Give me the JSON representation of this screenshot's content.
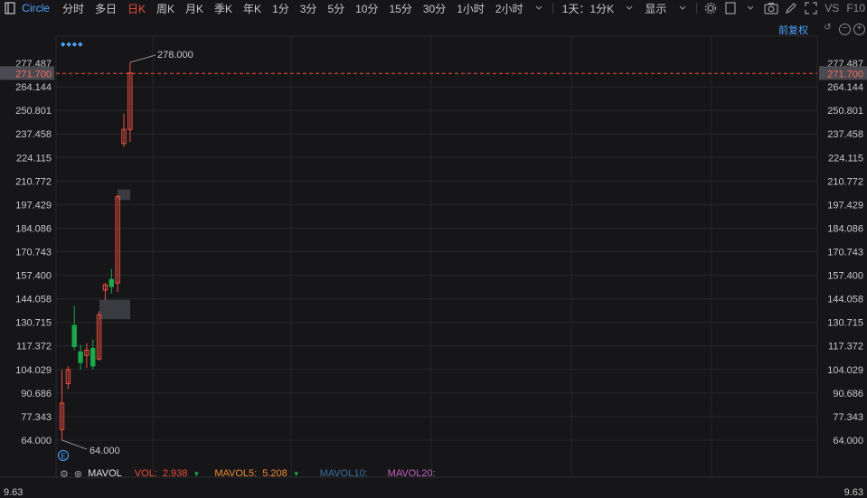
{
  "toolbar": {
    "symbol": "Circle",
    "intervals": [
      "分时",
      "多日",
      "日K",
      "周K",
      "月K",
      "季K",
      "年K",
      "1分",
      "3分",
      "5分",
      "10分",
      "15分",
      "30分",
      "1小时",
      "2小时"
    ],
    "active_interval": "日K",
    "range_selector": "1天：1分K",
    "display_label": "显示",
    "vs_label": "VS",
    "f10_label": "F10"
  },
  "chart_header": {
    "adjust_label": "前复权"
  },
  "price_axis": {
    "ticks": [
      "277.487",
      "264.144",
      "250.801",
      "237.458",
      "224.115",
      "210.772",
      "197.429",
      "184.086",
      "170.743",
      "157.400",
      "144.058",
      "130.715",
      "117.372",
      "104.029",
      "90.686",
      "77.343",
      "64.000"
    ],
    "current_price": "271.700"
  },
  "annotations": {
    "high_label": "278.000",
    "low_label": "64.000"
  },
  "volume_panel": {
    "indicator": "MAVOL",
    "vol_label": "VOL:",
    "vol_value": "2.938",
    "mavol5_label": "MAVOL5:",
    "mavol5_value": "5.208",
    "mavol10_label": "MAVOL10:",
    "mavol20_label": "MAVOL20:",
    "axis_value": "9.63"
  },
  "colors": {
    "up": "#ef4f3f",
    "down": "#1aa84a",
    "accent": "#4da3ff",
    "mavol5": "#f08a30",
    "mavol10": "#3a6fa0",
    "mavol20": "#c060c0"
  },
  "chart_data": {
    "type": "candlestick",
    "ylim": [
      64.0,
      277.487
    ],
    "candles": [
      {
        "o": 70,
        "h": 104,
        "l": 64,
        "c": 85
      },
      {
        "o": 96,
        "h": 106,
        "l": 93,
        "c": 104
      },
      {
        "o": 129,
        "h": 140,
        "l": 115,
        "c": 117
      },
      {
        "o": 114,
        "h": 118,
        "l": 104,
        "c": 108
      },
      {
        "o": 112,
        "h": 119,
        "l": 105,
        "c": 115
      },
      {
        "o": 116,
        "h": 121,
        "l": 104,
        "c": 106
      },
      {
        "o": 110,
        "h": 137,
        "l": 109,
        "c": 135
      },
      {
        "o": 149,
        "h": 153,
        "l": 143,
        "c": 152
      },
      {
        "o": 155,
        "h": 161,
        "l": 147,
        "c": 151
      },
      {
        "o": 153,
        "h": 203,
        "l": 148,
        "c": 202
      },
      {
        "o": 232,
        "h": 249,
        "l": 230,
        "c": 240
      },
      {
        "o": 240,
        "h": 278,
        "l": 233,
        "c": 272
      }
    ]
  }
}
